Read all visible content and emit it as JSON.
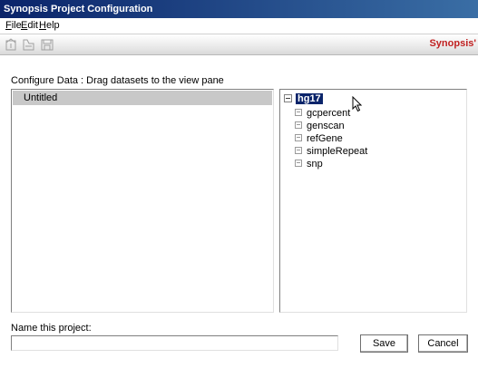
{
  "window": {
    "title": "Synopsis Project Configuration"
  },
  "menubar": {
    "items": [
      {
        "first": "F",
        "rest": "ile"
      },
      {
        "first": "E",
        "rest": "dit"
      },
      {
        "first": "H",
        "rest": "elp"
      }
    ]
  },
  "toolbar": {
    "buttons": [
      "new-project-icon",
      "open-project-icon",
      "save-project-icon"
    ],
    "brand": "Synopsis'"
  },
  "instruction": "Configure Data : Drag datasets to the view pane",
  "left_pane": {
    "items": [
      "Untitled"
    ]
  },
  "tree": {
    "root": "hg17",
    "children": [
      "gcpercent",
      "genscan",
      "refGene",
      "simpleRepeat",
      "snp"
    ]
  },
  "project_name": {
    "label": "Name this project:",
    "value": "",
    "placeholder": ""
  },
  "buttons": {
    "save": "Save",
    "cancel": "Cancel"
  },
  "colors": {
    "titlebar": "#0a246a",
    "selection": "#0a246a",
    "brand": "#c02020",
    "list_selected": "#c8c8c8"
  }
}
